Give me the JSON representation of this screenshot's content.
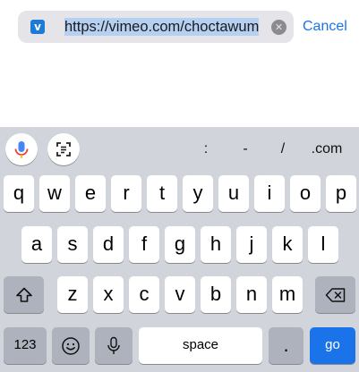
{
  "url_bar": {
    "favicon_letter": "v",
    "url_text": "https://vimeo.com/choctawum",
    "cancel_label": "Cancel"
  },
  "suggestion_bar": {
    "items": [
      ":",
      "-",
      "/",
      ".com"
    ]
  },
  "keyboard": {
    "row1": [
      "q",
      "w",
      "e",
      "r",
      "t",
      "y",
      "u",
      "i",
      "o",
      "p"
    ],
    "row2": [
      "a",
      "s",
      "d",
      "f",
      "g",
      "h",
      "j",
      "k",
      "l"
    ],
    "row3": [
      "z",
      "x",
      "c",
      "v",
      "b",
      "n",
      "m"
    ],
    "numbers_label": "123",
    "space_label": "space",
    "period_label": ".",
    "go_label": "go"
  },
  "colors": {
    "accent": "#1a73e8",
    "keyboard_bg": "#d1d4da",
    "url_field_bg": "#e4e4e9"
  }
}
